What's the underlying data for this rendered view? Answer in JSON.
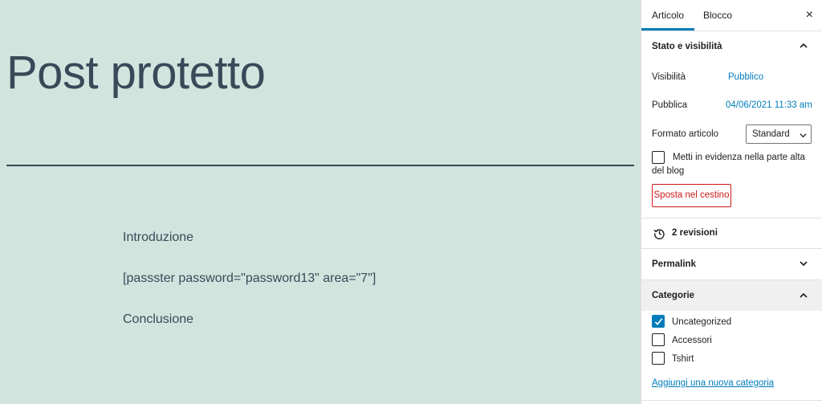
{
  "editor": {
    "post_title": "Post protetto",
    "paragraphs": [
      "Introduzione",
      "[passster password=\"password13\" area=\"7\"]",
      "Conclusione"
    ]
  },
  "sidebar": {
    "tabs": [
      "Articolo",
      "Blocco"
    ],
    "close_label": "×",
    "status_panel": {
      "title": "Stato e visibilità",
      "visibility_label": "Visibilità",
      "visibility_value": "Pubblico",
      "publish_label": "Pubblica",
      "publish_value": "04/06/2021 11:33 am",
      "format_label": "Formato articolo",
      "format_value": "Standard",
      "sticky_label": "Metti in evidenza nella parte alta del blog",
      "sticky_checked": false,
      "trash_label": "Sposta nel cestino"
    },
    "revisions_label": "2 revisioni",
    "permalink_title": "Permalink",
    "categories_panel": {
      "title": "Categorie",
      "items": [
        {
          "label": "Uncategorized",
          "checked": true
        },
        {
          "label": "Accessori",
          "checked": false
        },
        {
          "label": "Tshirt",
          "checked": false
        }
      ],
      "add_label": "Aggiungi una nuova categoria"
    }
  },
  "colors": {
    "canvas_bg": "#d2e4de",
    "title_text": "#384a58",
    "accent": "#007cba",
    "danger": "#cc1818"
  }
}
